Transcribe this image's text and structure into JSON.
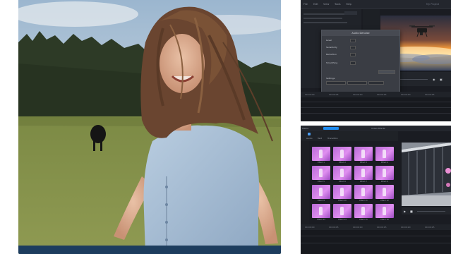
{
  "photo": {
    "caption": "",
    "alt_subject": "woman-laughing-in-field"
  },
  "editor_top": {
    "window_title": "",
    "menu": [
      "File",
      "Edit",
      "View",
      "Tools",
      "Help"
    ],
    "user_badge": "My Project",
    "dialog": {
      "title": "Audio Denoise",
      "rows": [
        "Level",
        "Sensitivity",
        "Reduction",
        "Smoothing"
      ],
      "section": "Settings",
      "ok_label": "",
      "cancel_label": ""
    },
    "preview_subject": "drone-over-sunset-clouds",
    "timeline_times": [
      "00:00:00",
      "00:00:05",
      "00:00:10",
      "00:00:15",
      "00:00:20",
      "00:00:25"
    ]
  },
  "editor_bottom": {
    "tabs": [
      "Media",
      "Audio",
      "Text",
      "Transition",
      "Effects"
    ],
    "active_tab": "Effects",
    "panel_title": "Video Effects",
    "effects": [
      "Effect 1",
      "Effect 2",
      "Effect 3",
      "Effect 4",
      "Effect 5",
      "Effect 6",
      "Effect 7",
      "Effect 8",
      "Effect 9",
      "Effect 10",
      "Effect 11",
      "Effect 12",
      "Effect 13",
      "Effect 14",
      "Effect 15",
      "Effect 16"
    ],
    "preview_subject": "modern-building-glass-facade",
    "timeline_times": [
      "00:00:00",
      "00:00:05",
      "00:00:10",
      "00:00:15",
      "00:00:20",
      "00:00:25"
    ]
  },
  "colors": {
    "caption_bar": "#1d3d5e",
    "app_bg": "#1a1c22",
    "accent": "#1f8cf0",
    "effect_thumb": "#c77ae0"
  }
}
